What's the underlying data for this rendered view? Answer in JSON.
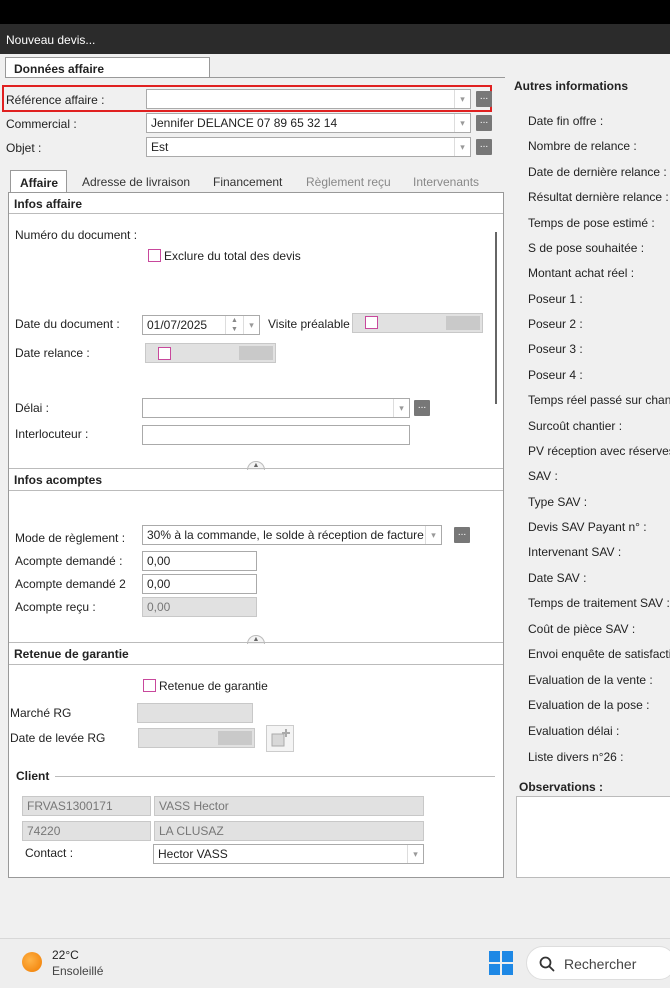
{
  "window": {
    "title": "Nouveau devis..."
  },
  "main_tab": "Données affaire",
  "header_fields": {
    "reference": {
      "label": "Référence affaire :",
      "value": ""
    },
    "commercial": {
      "label": "Commercial :",
      "value": "Jennifer DELANCE 07 89 65 32 14"
    },
    "objet": {
      "label": "Objet :",
      "value": "Est"
    }
  },
  "subtabs": [
    {
      "label": "Affaire"
    },
    {
      "label": "Adresse de livraison"
    },
    {
      "label": "Financement"
    },
    {
      "label": "Règlement reçu"
    },
    {
      "label": "Intervenants"
    }
  ],
  "infos_affaire": {
    "title": "Infos affaire",
    "numero_label": "Numéro du document :",
    "exclure_label": "Exclure du total des devis",
    "date_doc_label": "Date du document :",
    "date_doc_value": "01/07/2025",
    "visite_label": "Visite préalable",
    "date_relance_label": "Date relance :",
    "delai_label": "Délai :",
    "interlocuteur_label": "Interlocuteur :"
  },
  "infos_acomptes": {
    "title": "Infos acomptes",
    "mode_label": "Mode de règlement :",
    "mode_value": "30% à la commande, le solde à réception de facture",
    "acompte1_label": "Acompte demandé :",
    "acompte1_value": "0,00",
    "acompte2_label": "Acompte demandé 2",
    "acompte2_value": "0,00",
    "acompte_recu_label": "Acompte reçu :",
    "acompte_recu_value": "0,00"
  },
  "retenue": {
    "title": "Retenue de garantie",
    "checkbox_label": "Retenue de garantie",
    "marche_label": "Marché RG",
    "date_levee_label": "Date de levée RG"
  },
  "client": {
    "title": "Client",
    "code": "FRVAS1300171",
    "name": "VASS Hector",
    "zip": "74220",
    "city": "LA CLUSAZ",
    "contact_label": "Contact :",
    "contact_value": "Hector VASS"
  },
  "autres": {
    "title": "Autres informations",
    "items": [
      "Date fin offre :",
      "Nombre de relance :",
      "Date de dernière relance :",
      "Résultat dernière relance :",
      "Temps de pose estimé :",
      "S de pose souhaitée :",
      "Montant achat réel :",
      "Poseur 1 :",
      "Poseur 2 :",
      "Poseur 3 :",
      "Poseur 4 :",
      "Temps réel passé sur chantier",
      "Surcoût chantier :",
      "PV réception avec réserves :",
      "SAV :",
      "Type SAV :",
      "Devis SAV Payant n° :",
      "Intervenant SAV :",
      "Date SAV :",
      "Temps de traitement SAV :",
      "Coût de pièce SAV :",
      "Envoi enquête de satisfaction",
      "Evaluation de la vente :",
      "Evaluation de la pose :",
      "Evaluation délai :",
      "Liste divers n°26 :"
    ],
    "observations_label": "Observations :"
  },
  "taskbar": {
    "temp": "22°C",
    "weather": "Ensoleillé",
    "search_label": "Rechercher"
  },
  "ui": {
    "dots": "..."
  }
}
